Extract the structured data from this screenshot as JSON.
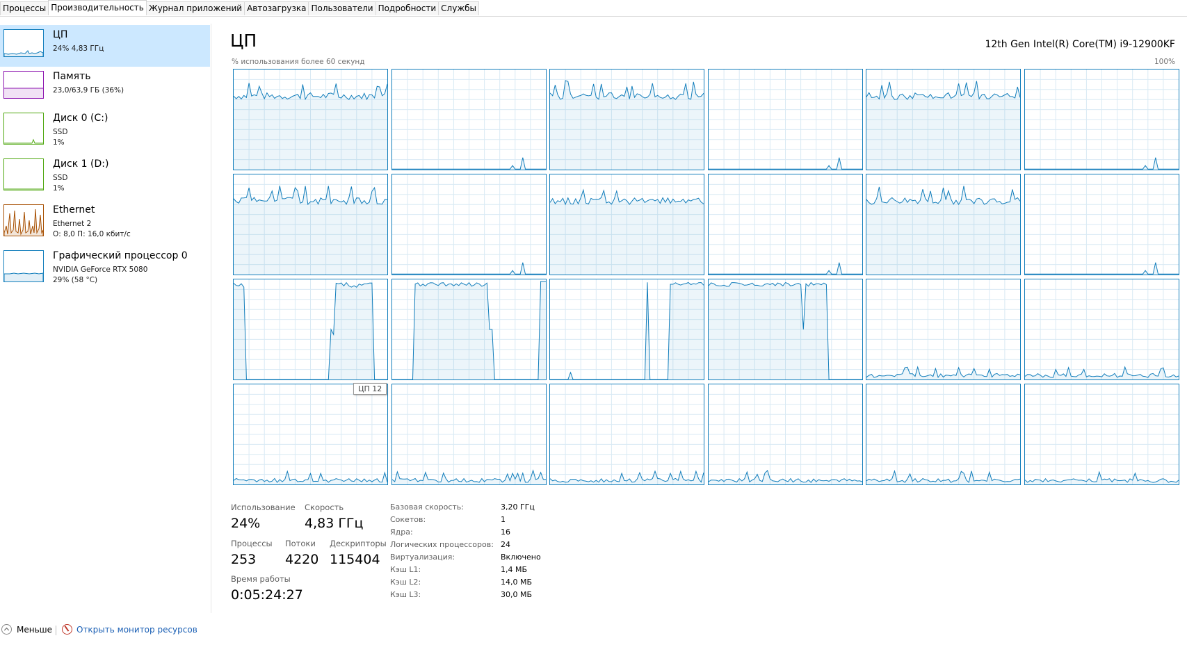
{
  "tabs": [
    "Процессы",
    "Производительность",
    "Журнал приложений",
    "Автозагрузка",
    "Пользователи",
    "Подробности",
    "Службы"
  ],
  "active_tab": 1,
  "sidebar": {
    "items": [
      {
        "title": "ЦП",
        "line1": "24% 4,83 ГГц",
        "line2": "",
        "color": "#117dbb",
        "icon": "cpu-graph-thumbnail"
      },
      {
        "title": "Память",
        "line1": "23,0/63,9 ГБ (36%)",
        "line2": "",
        "color": "#8b12ae",
        "icon": "memory-graph-thumbnail"
      },
      {
        "title": "Диск 0 (C:)",
        "line1": "SSD",
        "line2": "1%",
        "color": "#4da60c",
        "icon": "disk-graph-thumbnail"
      },
      {
        "title": "Диск 1 (D:)",
        "line1": "SSD",
        "line2": "1%",
        "color": "#4da60c",
        "icon": "disk-graph-thumbnail"
      },
      {
        "title": "Ethernet",
        "line1": "Ethernet 2",
        "line2": "О: 8,0 П: 16,0 кбит/с",
        "color": "#a74f01",
        "icon": "network-graph-thumbnail"
      },
      {
        "title": "Графический процессор 0",
        "line1": "NVIDIA GeForce RTX 5080",
        "line2": "29% (58 °C)",
        "color": "#117dbb",
        "icon": "gpu-graph-thumbnail"
      }
    ]
  },
  "main": {
    "title": "ЦП",
    "model": "12th Gen Intel(R) Core(TM) i9-12900KF",
    "graph_caption": "% использования более 60 секунд",
    "graph_max": "100%",
    "tooltip": "ЦП 12",
    "accent_color": "#117dbb",
    "logical_cpu_count": 24
  },
  "stats": {
    "usage_label": "Использование",
    "usage_value": "24%",
    "speed_label": "Скорость",
    "speed_value": "4,83 ГГц",
    "processes_label": "Процессы",
    "processes_value": "253",
    "threads_label": "Потоки",
    "threads_value": "4220",
    "handles_label": "Дескрипторы",
    "handles_value": "115404",
    "uptime_label": "Время работы",
    "uptime_value": "0:05:24:27"
  },
  "info": [
    {
      "label": "Базовая скорость:",
      "value": "3,20 ГГц"
    },
    {
      "label": "Сокетов:",
      "value": "1"
    },
    {
      "label": "Ядра:",
      "value": "16"
    },
    {
      "label": "Логических процессоров:",
      "value": "24"
    },
    {
      "label": "Виртуализация:",
      "value": "Включено"
    },
    {
      "label": "Кэш L1:",
      "value": "1,4 МБ"
    },
    {
      "label": "Кэш L2:",
      "value": "14,0 МБ"
    },
    {
      "label": "Кэш L3:",
      "value": "30,0 МБ"
    }
  ],
  "footer": {
    "less_label": "Меньше",
    "resmon_label": "Открыть монитор ресурсов"
  }
}
